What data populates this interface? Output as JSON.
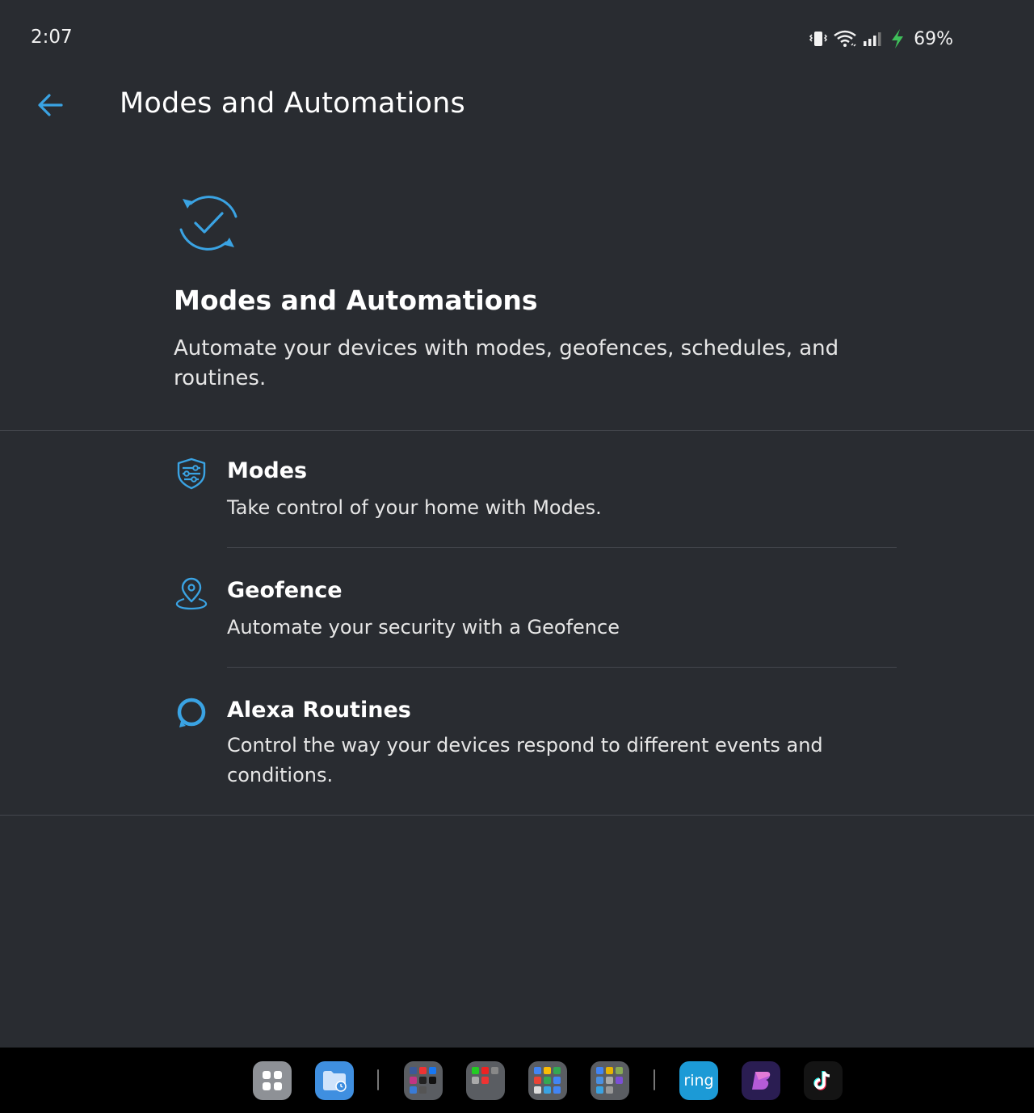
{
  "status_bar": {
    "time": "2:07",
    "battery": "69%",
    "icons": [
      "vibrate-icon",
      "wifi-icon",
      "signal-icon",
      "charging-icon"
    ]
  },
  "header": {
    "title": "Modes and Automations",
    "back_icon": "arrow-left-icon"
  },
  "hero": {
    "icon": "sync-check-icon",
    "title": "Modes and Automations",
    "description": "Automate your devices with modes, geofences, schedules, and routines."
  },
  "items": [
    {
      "icon": "modes-shield-icon",
      "title": "Modes",
      "description": "Take control of your home with Modes."
    },
    {
      "icon": "geofence-pin-icon",
      "title": "Geofence",
      "description": "Automate your security with a Geofence"
    },
    {
      "icon": "alexa-ring-icon",
      "title": "Alexa Routines",
      "description": "Control the way your devices respond to different events and conditions."
    }
  ],
  "dock": {
    "ring_label": "ring"
  },
  "colors": {
    "background": "#292c31",
    "accent": "#3aa3e3",
    "divider": "#44474d",
    "charging": "#3fbf5a"
  }
}
